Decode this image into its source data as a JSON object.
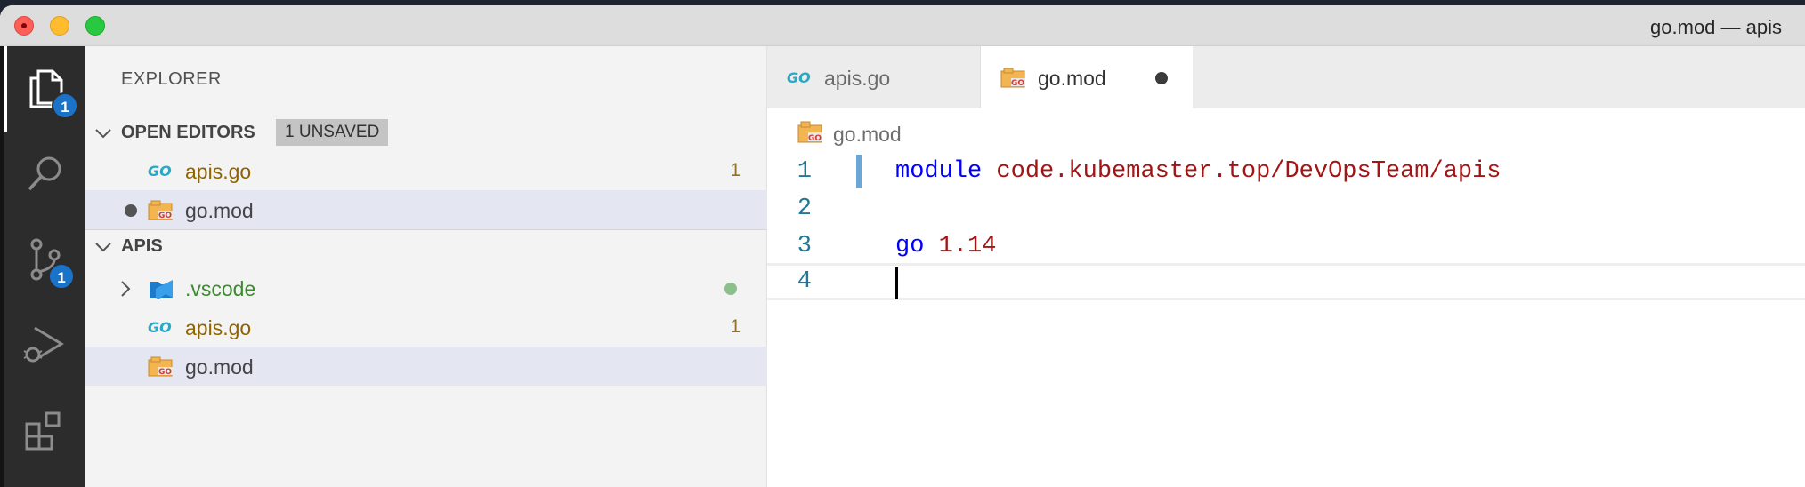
{
  "window": {
    "title": "go.mod — apis"
  },
  "activity_bar": {
    "items": [
      {
        "icon": "files-icon",
        "badge": "1"
      },
      {
        "icon": "search-icon"
      },
      {
        "icon": "source-control-icon",
        "badge": "1"
      },
      {
        "icon": "run-debug-icon"
      },
      {
        "icon": "extensions-icon"
      }
    ]
  },
  "sidebar": {
    "title": "EXPLORER",
    "open_editors": {
      "label": "OPEN EDITORS",
      "badge": "1 UNSAVED",
      "items": [
        {
          "name": "apis.go",
          "problems": "1",
          "icon": "go-file-icon"
        },
        {
          "name": "go.mod",
          "icon": "go-mod-file-icon",
          "dirty": true
        }
      ]
    },
    "folder": {
      "label": "APIS",
      "items": [
        {
          "name": ".vscode",
          "icon": "vscode-folder-icon",
          "type": "folder"
        },
        {
          "name": "apis.go",
          "problems": "1",
          "icon": "go-file-icon"
        },
        {
          "name": "go.mod",
          "icon": "go-mod-file-icon"
        }
      ]
    }
  },
  "editor": {
    "tabs": [
      {
        "name": "apis.go",
        "icon": "go-file-icon",
        "active": false
      },
      {
        "name": "go.mod",
        "icon": "go-mod-file-icon",
        "active": true,
        "dirty": true
      }
    ],
    "breadcrumb": "go.mod",
    "lines": [
      {
        "number": "1",
        "keyword": "module",
        "rest": "code.kubemaster.top/DevOpsTeam/apis"
      },
      {
        "number": "2",
        "keyword": "",
        "rest": ""
      },
      {
        "number": "3",
        "keyword": "go",
        "rest": "1.14"
      },
      {
        "number": "4",
        "keyword": "",
        "rest": ""
      }
    ]
  },
  "colors": {
    "keyword": "#0000ff",
    "string": "#a31515",
    "line_number": "#237893",
    "badge": "#1a73c9"
  }
}
